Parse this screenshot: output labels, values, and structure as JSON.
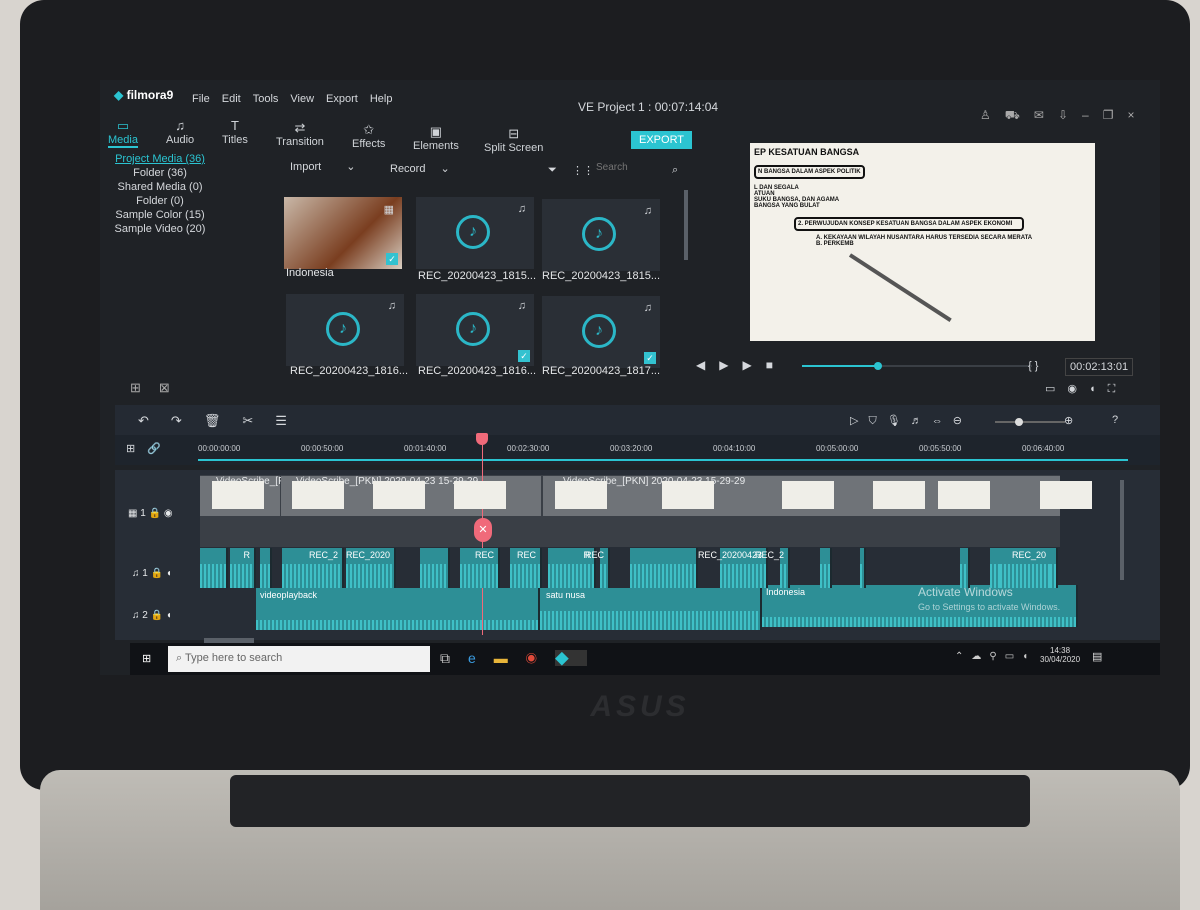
{
  "app": {
    "logo": "filmora9",
    "title": "VE Project 1 : 00:07:14:04",
    "menu": [
      "File",
      "Edit",
      "Tools",
      "View",
      "Export",
      "Help"
    ],
    "export_label": "EXPORT",
    "accent": "#2bc4d1"
  },
  "tabs": [
    {
      "label": "Media",
      "icon": "folder-icon"
    },
    {
      "label": "Audio",
      "icon": "music-icon"
    },
    {
      "label": "Titles",
      "icon": "text-icon"
    },
    {
      "label": "Transition",
      "icon": "transition-icon"
    },
    {
      "label": "Effects",
      "icon": "effects-icon"
    },
    {
      "label": "Elements",
      "icon": "image-icon"
    },
    {
      "label": "Split Screen",
      "icon": "split-screen-icon"
    }
  ],
  "sidebar": [
    "Project Media (36)",
    "Folder (36)",
    "Shared Media (0)",
    "Folder (0)",
    "Sample Color (15)",
    "Sample Video (20)"
  ],
  "media_bar": {
    "import": "Import",
    "record": "Record",
    "search_placeholder": "Search"
  },
  "media": [
    "Indonesia",
    "REC_20200423_1815...",
    "REC_20200423_1815...",
    "REC_20200423_1816...",
    "REC_20200423_1816...",
    "REC_20200423_1817..."
  ],
  "preview": {
    "lines": [
      "EP KESATUAN BANGSA",
      "N BANGSA DALAM ASPEK POLITIK",
      "L DAN SEGALA",
      "ATUAN",
      "SUKU BANGSA, DAN AGAMA",
      "BANGSA YANG BULAT",
      "2.  PERWUJUDAN KONSEP KESATUAN BANGSA DALAM ASPEK EKONOMI",
      "A. KEKAYAAN WILAYAH NUSANTARA HARUS TERSEDIA SECARA MERATA",
      "B. PERKEMB"
    ],
    "timecode": "00:02:13:01",
    "progress": 0.33
  },
  "timeline": {
    "ticks": [
      "00:00:00:00",
      "00:00:50:00",
      "00:01:40:00",
      "00:02:30:00",
      "00:03:20:00",
      "00:04:10:00",
      "00:05:00:00",
      "00:05:50:00",
      "00:06:40:00"
    ],
    "tracks": [
      "1",
      "1",
      "2"
    ],
    "video_clips": [
      "VideoScribe_[PK",
      "VideoScribe_[PKN] 2020-04-23 15-29-29",
      "VideoScribe_[PKN] 2020-04-23 15-29-29"
    ],
    "audio1_clips": [
      "R",
      "REC_2",
      "REC_2020",
      "REC",
      "REC",
      "R",
      "REC",
      "REC_20200423",
      "REC_2",
      "REC_20"
    ],
    "audio2_clips": [
      "videoplayback",
      "satu nusa",
      "Indonesia"
    ]
  },
  "watermark": {
    "title": "Activate Windows",
    "sub": "Go to Settings to activate Windows."
  },
  "taskbar": {
    "search_placeholder": "Type here to search",
    "time": "14:38",
    "date": "30/04/2020"
  },
  "laptop_brand": "ASUS"
}
